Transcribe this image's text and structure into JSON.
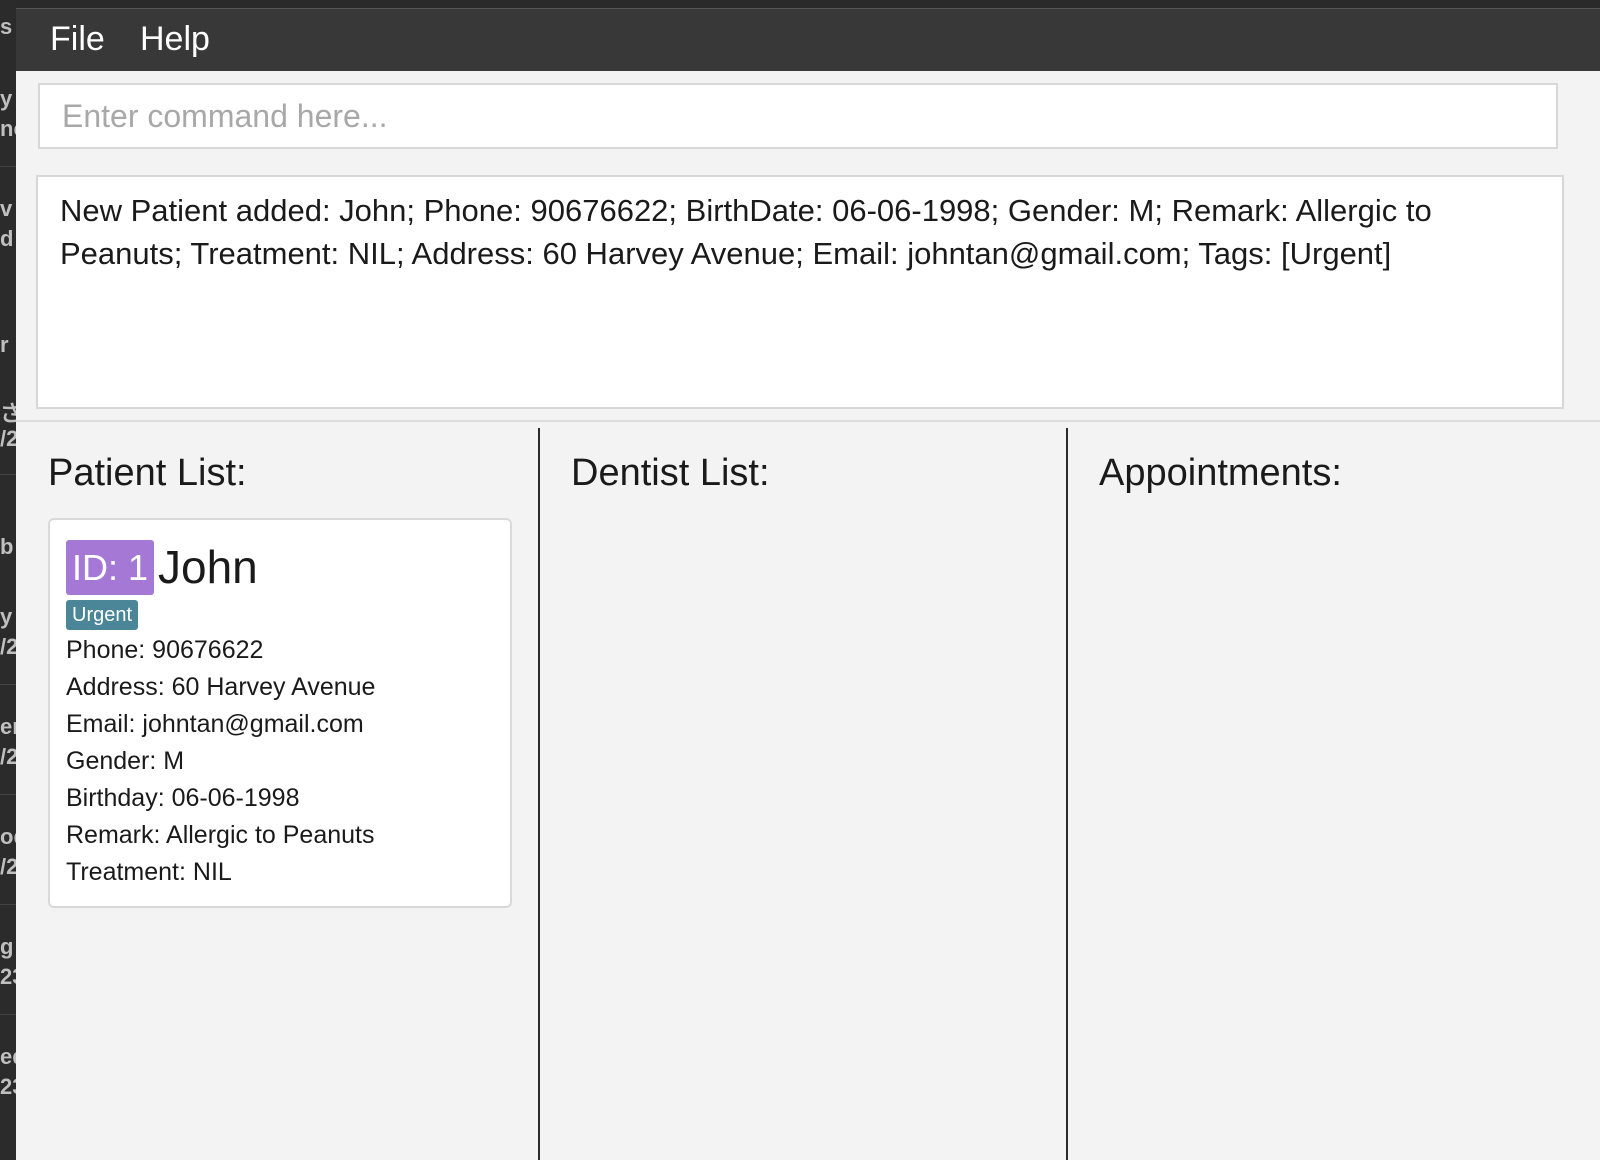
{
  "background_window_fragments": [
    "s",
    "y l",
    "nc",
    "v",
    "d",
    "r",
    "さ",
    "/2",
    "b",
    "y l",
    "/2",
    "er",
    "/2",
    "od",
    "/2",
    "g S",
    "23",
    "ed",
    "23"
  ],
  "menu": {
    "items": [
      {
        "label": "File"
      },
      {
        "label": "Help"
      }
    ]
  },
  "command": {
    "placeholder": "Enter command here...",
    "value": ""
  },
  "result": {
    "text": "New Patient added: John; Phone: 90676622; BirthDate: 06-06-1998; Gender: M; Remark: Allergic to Peanuts; Treatment: NIL; Address: 60 Harvey Avenue; Email: johntan@gmail.com; Tags: [Urgent]"
  },
  "panels": {
    "patients": {
      "title": "Patient List:",
      "items": [
        {
          "id_label": "ID: 1",
          "name": "John",
          "tags": [
            "Urgent"
          ],
          "phone": "Phone: 90676622",
          "address": "Address: 60 Harvey Avenue",
          "email": "Email: johntan@gmail.com",
          "gender": "Gender: M",
          "birthday": "Birthday: 06-06-1998",
          "remark": "Remark: Allergic to Peanuts",
          "treatment": "Treatment: NIL"
        }
      ]
    },
    "dentists": {
      "title": "Dentist List:",
      "items": []
    },
    "appointments": {
      "title": "Appointments:",
      "items": []
    }
  },
  "colors": {
    "menubar": "#383838",
    "id_badge": "#a678d6",
    "tag": "#4b8598",
    "app_background": "#f3f3f3"
  }
}
